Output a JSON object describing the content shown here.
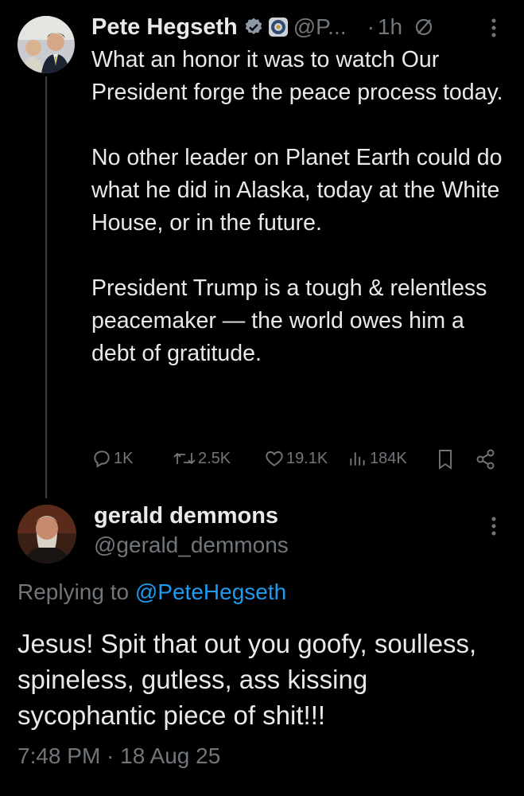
{
  "tweet": {
    "author_name": "Pete Hegseth",
    "handle": "@P...",
    "separator": "·",
    "time": "1h",
    "paragraphs": [
      "What an honor it was to watch Our President forge the peace process today.",
      "No other leader on Planet Earth could do what he did in Alaska, today at the White House, or in the future.",
      "President Trump is a tough & relentless peacemaker — the world owes him a debt of gratitude."
    ],
    "stats": {
      "replies": "1K",
      "reposts": "2.5K",
      "likes": "19.1K",
      "views": "184K"
    }
  },
  "reply": {
    "author_name": "gerald demmons",
    "handle": "@gerald_demmons",
    "replying_prefix": "Replying to",
    "replying_to": "@PeteHegseth",
    "text": "Jesus!  Spit that out you goofy, soulless,  spineless,  gutless,  ass kissing sycophantic piece of shit!!!",
    "timestamp": "7:48 PM · 18 Aug 25"
  },
  "colors": {
    "background": "#000000",
    "text": "#e7e9ea",
    "muted": "#71767b",
    "link": "#1d9bf0",
    "thread_line": "#3a3d40"
  },
  "icons": [
    "verified-badge-icon",
    "government-seal-icon",
    "not-interested-icon",
    "more-options-icon",
    "reply-icon",
    "repost-icon",
    "like-icon",
    "views-icon",
    "bookmark-icon",
    "share-icon"
  ]
}
